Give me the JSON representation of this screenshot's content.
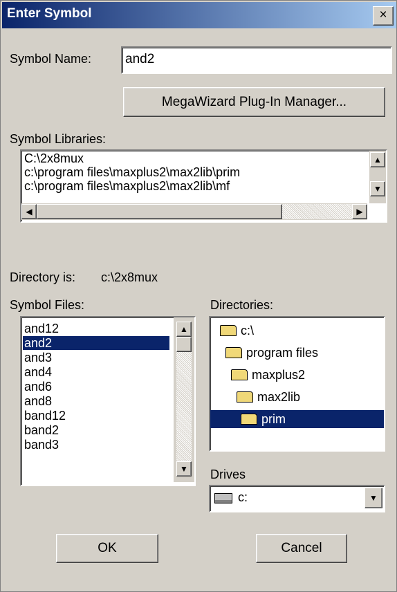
{
  "dialog": {
    "title": "Enter Symbol",
    "close_glyph": "×"
  },
  "symbol_name": {
    "label": "Symbol Name:",
    "value": "and2"
  },
  "megawizard_button": "MegaWizard Plug-In Manager...",
  "libraries": {
    "label": "Symbol Libraries:",
    "items": [
      "C:\\2x8mux",
      "c:\\program files\\maxplus2\\max2lib\\prim",
      "c:\\program files\\maxplus2\\max2lib\\mf"
    ]
  },
  "directory": {
    "label": "Directory is:",
    "value": "c:\\2x8mux"
  },
  "symbol_files": {
    "label": "Symbol Files:",
    "items": [
      "and12",
      "and2",
      "and3",
      "and4",
      "and6",
      "and8",
      "band12",
      "band2",
      "band3"
    ],
    "selected": "and2"
  },
  "directories": {
    "label": "Directories:",
    "items": [
      "c:\\",
      "program files",
      "maxplus2",
      "max2lib",
      "prim"
    ],
    "selected": "prim"
  },
  "drives": {
    "label": "Drives",
    "value": "c:"
  },
  "buttons": {
    "ok": "OK",
    "cancel": "Cancel"
  },
  "colors": {
    "selection": "#0a246a",
    "face": "#d4d0c8"
  }
}
